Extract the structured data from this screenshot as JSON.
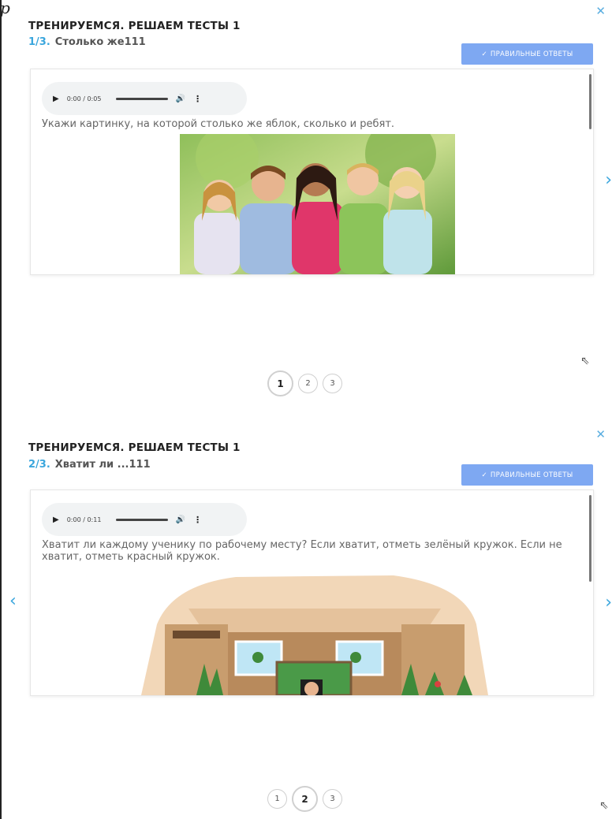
{
  "corner_mark": "р",
  "panels": [
    {
      "title": "ТРЕНИРУЕМСЯ. РЕШАЕМ ТЕСТЫ 1",
      "counter": "1/3.",
      "question_title": "Столько же111",
      "answers_label": "ПРАВИЛЬНЫЕ ОТВЕТЫ",
      "audio_time": "0:00 / 0:05",
      "question_text": "Укажи картинку, на которой столько же яблок, сколько и ребят.",
      "pages": [
        "1",
        "2",
        "3"
      ],
      "active_page": 1
    },
    {
      "title": "ТРЕНИРУЕМСЯ. РЕШАЕМ ТЕСТЫ 1",
      "counter": "2/3.",
      "question_title": "Хватит ли ...111",
      "answers_label": "ПРАВИЛЬНЫЕ ОТВЕТЫ",
      "audio_time": "0:00 / 0:11",
      "question_text": "Хватит ли каждому ученику по рабочему месту? Если хватит, отметь зелёный кружок. Если не хватит, отметь красный кружок.",
      "pages": [
        "1",
        "2",
        "3"
      ],
      "active_page": 2
    }
  ],
  "icons": {
    "close": "close-icon",
    "check": "check-icon",
    "play": "play-icon",
    "volume": "volume-icon",
    "more": "more-vertical-icon",
    "prev": "chevron-left-icon",
    "next": "chevron-right-icon"
  },
  "colors": {
    "accent": "#3aa6dd",
    "answers_button": "#7ea8f2"
  }
}
